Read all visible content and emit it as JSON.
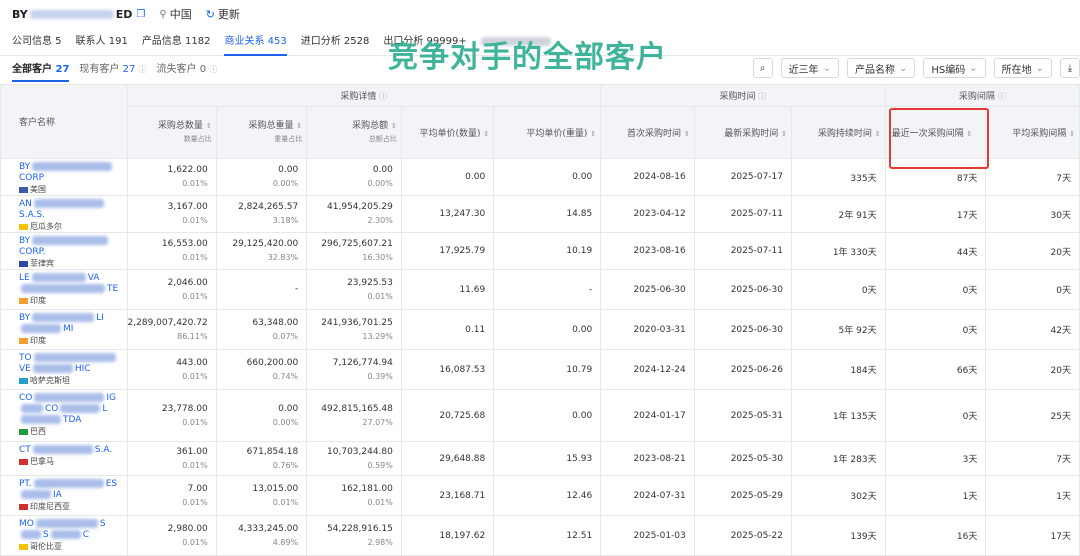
{
  "header": {
    "company_prefix": "BY",
    "company_suffix": "ED",
    "location_label": "中国",
    "refresh_label": "更新"
  },
  "tabs": [
    {
      "label": "公司信息 5"
    },
    {
      "label": "联系人 191"
    },
    {
      "label": "产品信息 1182"
    },
    {
      "label": "商业关系 453"
    },
    {
      "label": "进口分析 2528"
    },
    {
      "label": "出口分析 99999+"
    }
  ],
  "subtabs": [
    {
      "label": "全部客户",
      "count": "27"
    },
    {
      "label": "现有客户",
      "count": "27"
    },
    {
      "label": "流失客户 0",
      "count": ""
    }
  ],
  "overlay_title": "竞争对手的全部客户",
  "filters": {
    "range": "近三年",
    "product": "产品名称",
    "hs": "HS编码",
    "location": "所在地"
  },
  "table": {
    "group_headers": {
      "details": "采购详情",
      "time": "采购时间",
      "interval": "采购间隔"
    },
    "columns": {
      "name": "客户名称",
      "qty": "采购总数量",
      "qty_sub": "数量占比",
      "weight": "采购总重量",
      "weight_sub": "重量占比",
      "amount": "采购总额",
      "amount_sub": "总额占比",
      "unit_qty": "平均单价(数量)",
      "unit_weight": "平均单价(重量)",
      "first": "首次采购时间",
      "latest": "最新采购时间",
      "duration": "采购持续时间",
      "last_interval": "最近一次采购间隔",
      "avg_interval": "平均采购间隔"
    },
    "rows": [
      {
        "name1": "BY",
        "name2": "CORP",
        "country": "美国",
        "qty": "1,622.00",
        "qty_pct": "0.01%",
        "weight": "0.00",
        "weight_pct": "0.00%",
        "amount": "0.00",
        "amount_pct": "0.00%",
        "unit_qty": "0.00",
        "unit_weight": "0.00",
        "first": "2024-08-16",
        "latest": "2025-07-17",
        "duration": "335天",
        "last_interval": "87天",
        "avg_interval": "7天"
      },
      {
        "name1": "AN",
        "name2": "S.A.S.",
        "country": "厄瓜多尔",
        "qty": "3,167.00",
        "qty_pct": "0.01%",
        "weight": "2,824,265.57",
        "weight_pct": "3.18%",
        "amount": "41,954,205.29",
        "amount_pct": "2.30%",
        "unit_qty": "13,247.30",
        "unit_weight": "14.85",
        "first": "2023-04-12",
        "latest": "2025-07-11",
        "duration": "2年 91天",
        "last_interval": "17天",
        "avg_interval": "30天"
      },
      {
        "name1": "BY",
        "name2": "CORP.",
        "country": "菲律宾",
        "qty": "16,553.00",
        "qty_pct": "0.01%",
        "weight": "29,125,420.00",
        "weight_pct": "32.83%",
        "amount": "296,725,607.21",
        "amount_pct": "16.30%",
        "unit_qty": "17,925.79",
        "unit_weight": "10.19",
        "first": "2023-08-16",
        "latest": "2025-07-11",
        "duration": "1年 330天",
        "last_interval": "44天",
        "avg_interval": "20天"
      },
      {
        "name1": "LE",
        "name2": "VA",
        "name3": "TE",
        "country": "印度",
        "qty": "2,046.00",
        "qty_pct": "0.01%",
        "weight": "-",
        "weight_pct": "",
        "amount": "23,925.53",
        "amount_pct": "0.01%",
        "unit_qty": "11.69",
        "unit_weight": "-",
        "first": "2025-06-30",
        "latest": "2025-06-30",
        "duration": "0天",
        "last_interval": "0天",
        "avg_interval": "0天"
      },
      {
        "name1": "BY",
        "name2": "LI",
        "name3": "MI",
        "country": "印度",
        "qty": "2,289,007,420.72",
        "qty_pct": "86.11%",
        "weight": "63,348.00",
        "weight_pct": "0.07%",
        "amount": "241,936,701.25",
        "amount_pct": "13.29%",
        "unit_qty": "0.11",
        "unit_weight": "0.00",
        "first": "2020-03-31",
        "latest": "2025-06-30",
        "duration": "5年 92天",
        "last_interval": "0天",
        "avg_interval": "42天"
      },
      {
        "name1": "TO",
        "name2": "VE",
        "name3": "HIC",
        "country": "哈萨克斯坦",
        "qty": "443.00",
        "qty_pct": "0.01%",
        "weight": "660,200.00",
        "weight_pct": "0.74%",
        "amount": "7,126,774.94",
        "amount_pct": "0.39%",
        "unit_qty": "16,087.53",
        "unit_weight": "10.79",
        "first": "2024-12-24",
        "latest": "2025-06-26",
        "duration": "184天",
        "last_interval": "66天",
        "avg_interval": "20天"
      },
      {
        "name1": "CO",
        "name2": "IG",
        "name3": "CO",
        "name4": "L",
        "name5": "TDA",
        "country": "巴西",
        "qty": "23,778.00",
        "qty_pct": "0.01%",
        "weight": "0.00",
        "weight_pct": "0.00%",
        "amount": "492,815,165.48",
        "amount_pct": "27.07%",
        "unit_qty": "20,725.68",
        "unit_weight": "0.00",
        "first": "2024-01-17",
        "latest": "2025-05-31",
        "duration": "1年 135天",
        "last_interval": "0天",
        "avg_interval": "25天"
      },
      {
        "name1": "CT",
        "name2": "S.A.",
        "country": "巴拿马",
        "qty": "361.00",
        "qty_pct": "0.01%",
        "weight": "671,854.18",
        "weight_pct": "0.76%",
        "amount": "10,703,244.80",
        "amount_pct": "0.59%",
        "unit_qty": "29,648.88",
        "unit_weight": "15.93",
        "first": "2023-08-21",
        "latest": "2025-05-30",
        "duration": "1年 283天",
        "last_interval": "3天",
        "avg_interval": "7天"
      },
      {
        "name1": "PT.",
        "name2": "ES",
        "name3": "IA",
        "country": "印度尼西亚",
        "qty": "7.00",
        "qty_pct": "0.01%",
        "weight": "13,015.00",
        "weight_pct": "0.01%",
        "amount": "162,181.00",
        "amount_pct": "0.01%",
        "unit_qty": "23,168.71",
        "unit_weight": "12.46",
        "first": "2024-07-31",
        "latest": "2025-05-29",
        "duration": "302天",
        "last_interval": "1天",
        "avg_interval": "1天"
      },
      {
        "name1": "MO",
        "name2": "S",
        "name3": "S",
        "name4": "C",
        "country": "哥伦比亚",
        "qty": "2,980.00",
        "qty_pct": "0.01%",
        "weight": "4,333,245.00",
        "weight_pct": "4.89%",
        "amount": "54,228,916.15",
        "amount_pct": "2.98%",
        "unit_qty": "18,197.62",
        "unit_weight": "12.51",
        "first": "2025-01-03",
        "latest": "2025-05-22",
        "duration": "139天",
        "last_interval": "16天",
        "avg_interval": "17天"
      }
    ]
  },
  "flags": {
    "美国": "#3c5aa8",
    "厄瓜多尔": "#f2c300",
    "菲律宾": "#2b4aa0",
    "印度": "#f39c33",
    "哈萨克斯坦": "#27a0c9",
    "巴西": "#1e9a3e",
    "巴拿马": "#d32f2f",
    "印度尼西亚": "#d32f2f",
    "哥伦比亚": "#f2c300"
  },
  "highlight_color": "#e53935",
  "accent_color": "#1d63ed",
  "overlay_color": "#3fb49a"
}
